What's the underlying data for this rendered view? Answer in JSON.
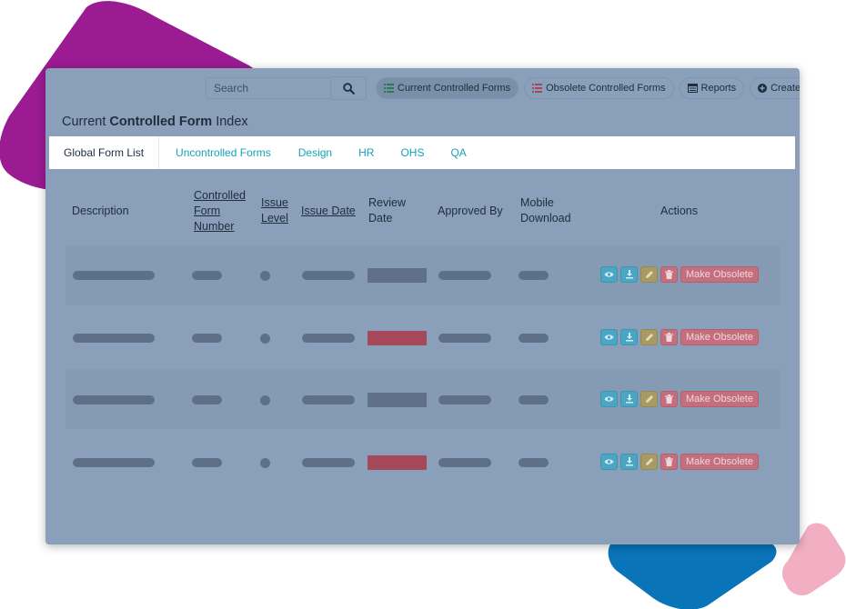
{
  "toolbar": {
    "search_placeholder": "Search",
    "buttons": [
      {
        "label": "Current Controlled Forms",
        "icon": "list-icon",
        "active": true
      },
      {
        "label": "Obsolete Controlled Forms",
        "icon": "list-icon",
        "active": false
      },
      {
        "label": "Reports",
        "icon": "report-icon",
        "active": false
      },
      {
        "label": "Create",
        "icon": "plus-circle-icon",
        "active": false
      }
    ]
  },
  "heading": {
    "prefix": "Current",
    "bold": "Controlled Form",
    "suffix": "Index"
  },
  "tabs": [
    {
      "label": "Global Form List",
      "active": true
    },
    {
      "label": "Uncontrolled Forms",
      "active": false
    },
    {
      "label": "Design",
      "active": false
    },
    {
      "label": "HR",
      "active": false
    },
    {
      "label": "OHS",
      "active": false
    },
    {
      "label": "QA",
      "active": false
    }
  ],
  "columns": {
    "description": "Description",
    "form_number": "Controlled Form Number",
    "issue_level": "Issue Level",
    "issue_date": "Issue Date",
    "review_date": "Review Date",
    "approved_by": "Approved By",
    "mobile_download": "Mobile Download",
    "actions": "Actions"
  },
  "rows": [
    {
      "review_status": "normal"
    },
    {
      "review_status": "overdue"
    },
    {
      "review_status": "normal"
    },
    {
      "review_status": "overdue"
    }
  ],
  "row_action_label": "Make Obsolete",
  "colors": {
    "purple_blob": "#9b1b93",
    "blue_blob": "#0a74b8",
    "pink_blob": "#f2aec3",
    "panel_overlay": "#8a9fb9",
    "accent_teal": "#17a2b8",
    "review_normal": "#607088",
    "review_overdue": "#a54859"
  }
}
